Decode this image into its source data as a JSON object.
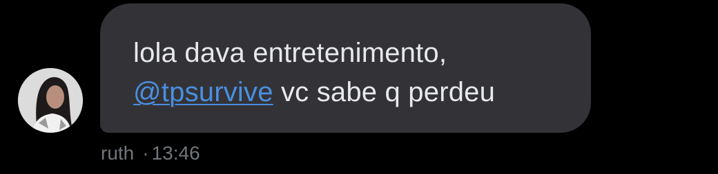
{
  "message": {
    "line1": "lola dava entretenimento,",
    "mention": "@tpsurvive",
    "line2_rest": " vc sabe q perdeu"
  },
  "sender": {
    "name": "ruth",
    "separator": "·",
    "time": "13:46"
  },
  "colors": {
    "background": "#000000",
    "bubble": "#333337",
    "text": "#e7e9ea",
    "mention": "#4a8fe0",
    "meta": "#71767b"
  },
  "icons": {
    "avatar": "profile-photo"
  }
}
